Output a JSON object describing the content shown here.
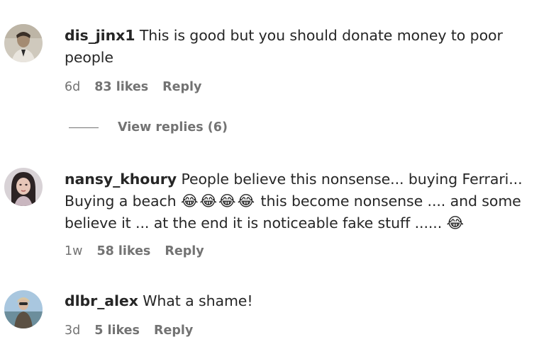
{
  "comments": [
    {
      "username": "dis_jinx1",
      "text": "This is good but you should donate money to poor people",
      "age": "6d",
      "likes": "83 likes",
      "reply": "Reply"
    },
    {
      "username": "nansy_khoury",
      "text_part1": "People believe this nonsense... buying Ferrari... Buying a beach",
      "emojis_inline": "😂😂😂😂",
      "text_part2": "this become nonsense .... and some believe it ... at the end it is noticeable fake stuff ......",
      "emoji_end": "😂",
      "age": "1w",
      "likes": "58 likes",
      "reply": "Reply"
    },
    {
      "username": "dlbr_alex",
      "text": "What a shame!",
      "age": "3d",
      "likes": "5 likes",
      "reply": "Reply"
    }
  ],
  "view_replies": "View replies (6)"
}
